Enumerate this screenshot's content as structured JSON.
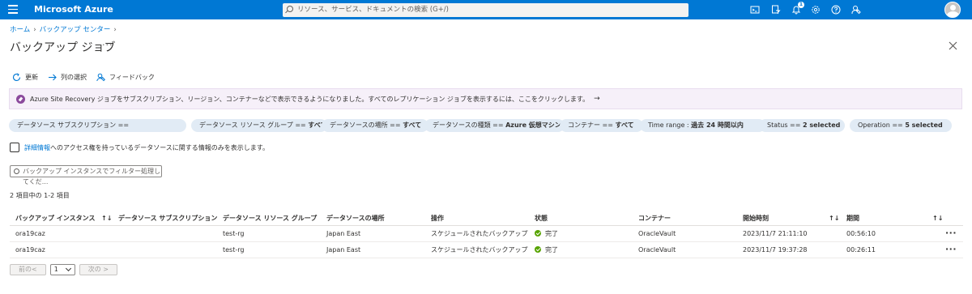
{
  "topbar": {
    "brand": "Microsoft Azure",
    "search_placeholder": "リソース、サービス、ドキュメントの検索 (G+/)",
    "notification_count": "1",
    "icons": [
      "cloud-shell-icon",
      "directory-filter-icon",
      "notifications-icon",
      "settings-icon",
      "help-icon",
      "feedback-icon"
    ]
  },
  "breadcrumb": {
    "home": "ホーム",
    "backup_center": "バックアップ センター"
  },
  "page": {
    "title": "バックアップ ジョブ",
    "more": "···"
  },
  "toolbar": {
    "refresh": "更新",
    "columns": "列の選択",
    "feedback": "フィードバック"
  },
  "banner": {
    "text": "Azure Site Recovery ジョブをサブスクリプション、リージョン、コンテナーなどで表示できるようになりました。すべてのレプリケーション ジョブを表示するには、ここをクリックします。",
    "arrow": "→"
  },
  "filters": [
    {
      "label": "データソース サブスクリプション ==",
      "value": ""
    },
    {
      "label": "データソース リソース グループ == ",
      "value": "すべて"
    },
    {
      "label": "データソースの場所 == ",
      "value": "すべて"
    },
    {
      "label": "データソースの種類 == ",
      "value": "Azure 仮想マシン"
    },
    {
      "label": "コンテナー == ",
      "value": "すべて"
    },
    {
      "label": "Time range : ",
      "value": "過去 24 時間以内"
    },
    {
      "label": "Status == ",
      "value": "2 selected"
    },
    {
      "label": "Operation == ",
      "value": "5 selected"
    }
  ],
  "access_check": {
    "link": "詳細情報",
    "text": " へのアクセス権を持っているデータソースに関する情報のみを表示します。"
  },
  "filter_input": {
    "placeholder": "バックアップ インスタンスでフィルター処理してくだ..."
  },
  "summary": {
    "count": "2 項目中の 1-2 項目"
  },
  "table": {
    "headers": [
      "バックアップ インスタンス",
      "データソース サブスクリプション",
      "データソース リソース グループ",
      "データソースの場所",
      "操作",
      "状態",
      "コンテナー",
      "開始時刻",
      "期間"
    ],
    "sort_icon": "↑↓",
    "rows": [
      {
        "instance": "ora19caz",
        "subscription": "",
        "resource_group": "test-rg",
        "location": "Japan East",
        "operation": "スケジュールされたバックアップ",
        "status": "完了",
        "vault": "OracleVault",
        "start": "2023/11/7 21:11:10",
        "duration": "00:56:10",
        "more": "···"
      },
      {
        "instance": "ora19caz",
        "subscription": "",
        "resource_group": "test-rg",
        "location": "Japan East",
        "operation": "スケジュールされたバックアップ",
        "status": "完了",
        "vault": "OracleVault",
        "start": "2023/11/7 19:37:28",
        "duration": "00:26:11",
        "more": "···"
      }
    ]
  },
  "pager": {
    "prev": "前の<",
    "page": "1",
    "next": "次の >"
  }
}
